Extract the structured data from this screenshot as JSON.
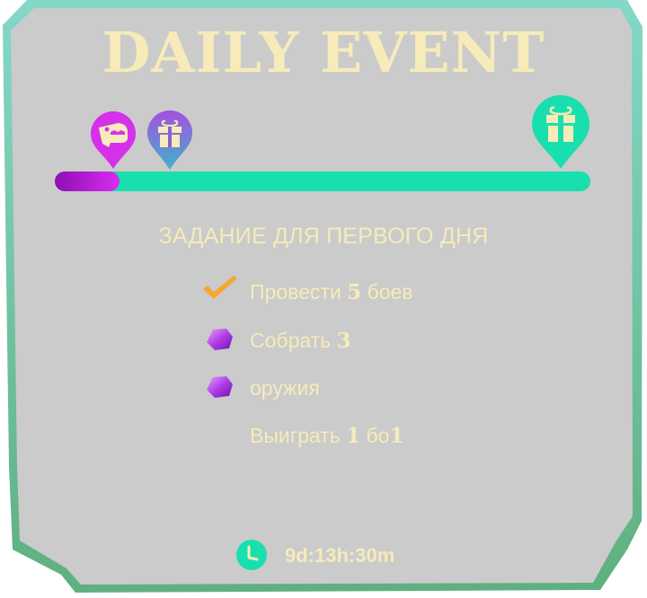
{
  "title": "DAILY EVENT",
  "progress": {
    "fraction": 0.12
  },
  "milestones": [
    {
      "icon": "dino-icon",
      "color": "#d531ea"
    },
    {
      "icon": "gift-icon",
      "color": "#8a5fd3"
    },
    {
      "icon": "gift-icon",
      "color": "#19dfae"
    }
  ],
  "task_heading": "ЗАДАНИЕ ДЛЯ ПЕРВОГО ДНЯ",
  "tasks": [
    {
      "status_icon": "checkmark-icon",
      "text_before": "Провести ",
      "number": "5",
      "text_after": " боев"
    },
    {
      "status_icon": "gem-icon",
      "text_before": "Собрать ",
      "number": "3",
      "text_after": ""
    },
    {
      "status_icon": "gem-icon",
      "text_before": "оружия",
      "number": "",
      "text_after": ""
    },
    {
      "status_icon": "",
      "text_before": "Выиграть ",
      "number": "1",
      "text_after": " бо",
      "number2": "1"
    }
  ],
  "timer": {
    "icon": "clock-icon",
    "value": "9d:13h:30m"
  },
  "colors": {
    "panel": "#cbcbcb",
    "border_top": "#7fd4c3",
    "border_bottom": "#62b488",
    "text": "#f6ebb9",
    "accent_green": "#19dfae",
    "accent_purple": "#c41fe0",
    "check": "#f4a733"
  }
}
